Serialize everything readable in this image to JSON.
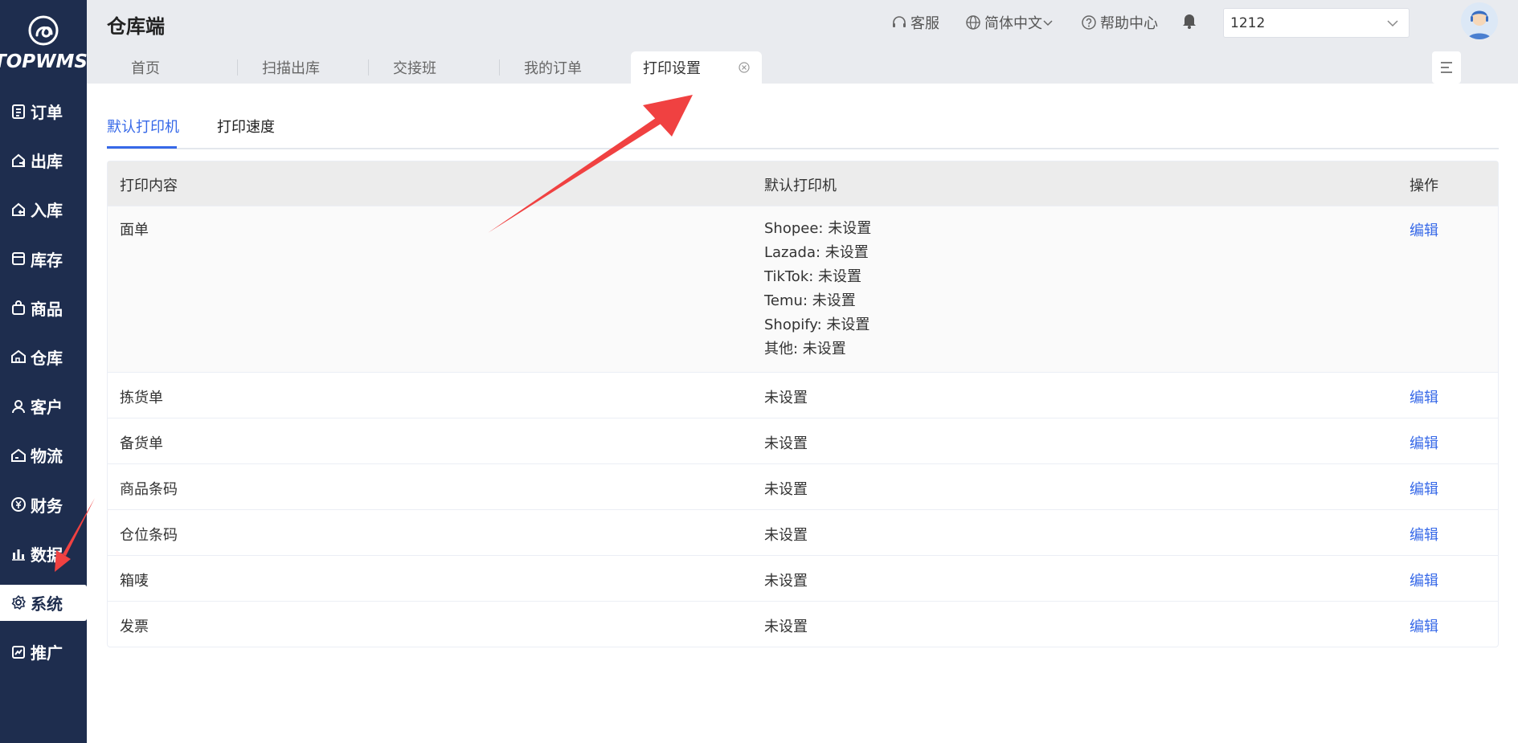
{
  "app": {
    "logo_text": "TOPWMS",
    "title": "仓库端"
  },
  "header": {
    "customer_service": "客服",
    "language": "简体中文",
    "help_center": "帮助中心",
    "warehouse_select_value": "1212"
  },
  "sidebar": {
    "items": [
      {
        "label": "订单",
        "icon": "order-icon"
      },
      {
        "label": "出库",
        "icon": "outbound-icon"
      },
      {
        "label": "入库",
        "icon": "inbound-icon"
      },
      {
        "label": "库存",
        "icon": "inventory-icon"
      },
      {
        "label": "商品",
        "icon": "product-bag-icon"
      },
      {
        "label": "仓库",
        "icon": "warehouse-icon"
      },
      {
        "label": "客户",
        "icon": "customer-icon"
      },
      {
        "label": "物流",
        "icon": "logistics-icon"
      },
      {
        "label": "财务",
        "icon": "finance-icon"
      },
      {
        "label": "数据",
        "icon": "data-chart-icon"
      },
      {
        "label": "系统",
        "icon": "gear-icon"
      },
      {
        "label": "推广",
        "icon": "promotion-icon"
      }
    ],
    "active": "系统"
  },
  "tabs": {
    "items": [
      "首页",
      "扫描出库",
      "交接班",
      "我的订单",
      "打印设置"
    ],
    "active": "打印设置"
  },
  "subtabs": {
    "items": [
      "默认打印机",
      "打印速度"
    ],
    "active": "默认打印机"
  },
  "table": {
    "headers": [
      "打印内容",
      "默认打印机",
      "操作"
    ],
    "first_row": {
      "content": "面单",
      "printers": [
        "Shopee: 未设置",
        "Lazada: 未设置",
        "TikTok: 未设置",
        "Temu: 未设置",
        "Shopify: 未设置",
        "其他: 未设置"
      ],
      "action": "编辑"
    },
    "rows": [
      {
        "content": "拣货单",
        "printer": "未设置",
        "action": "编辑"
      },
      {
        "content": "备货单",
        "printer": "未设置",
        "action": "编辑"
      },
      {
        "content": "商品条码",
        "printer": "未设置",
        "action": "编辑"
      },
      {
        "content": "仓位条码",
        "printer": "未设置",
        "action": "编辑"
      },
      {
        "content": "箱唛",
        "printer": "未设置",
        "action": "编辑"
      },
      {
        "content": "发票",
        "printer": "未设置",
        "action": "编辑"
      }
    ]
  },
  "colors": {
    "sidebar_bg": "#1e2d4e",
    "accent": "#3769e8",
    "annotation": "#f04141"
  }
}
